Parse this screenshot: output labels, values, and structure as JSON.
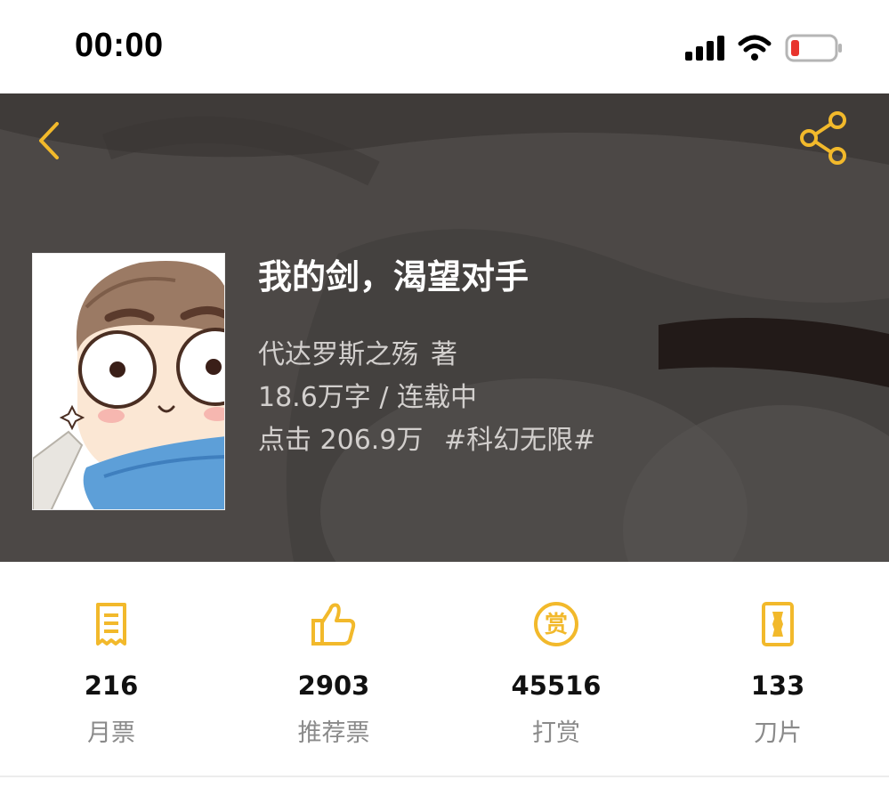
{
  "status_bar": {
    "time": "00:00"
  },
  "header": {
    "back_icon": "chevron-left-icon",
    "share_icon": "share-icon",
    "accent_color": "#f2b92b"
  },
  "book": {
    "title": "我的剑，渴望对手",
    "author": "代达罗斯之殇",
    "author_suffix": "著",
    "word_count": "18.6万字",
    "separator": "/",
    "status": "连载中",
    "clicks_label": "点击",
    "clicks_value": "206.9万",
    "tag": "#科幻无限#"
  },
  "stats": [
    {
      "icon": "monthly-ticket-icon",
      "value": "216",
      "label": "月票"
    },
    {
      "icon": "thumbs-up-icon",
      "value": "2903",
      "label": "推荐票"
    },
    {
      "icon": "reward-coin-icon",
      "value": "45516",
      "label": "打赏"
    },
    {
      "icon": "blade-card-icon",
      "value": "133",
      "label": "刀片"
    }
  ]
}
